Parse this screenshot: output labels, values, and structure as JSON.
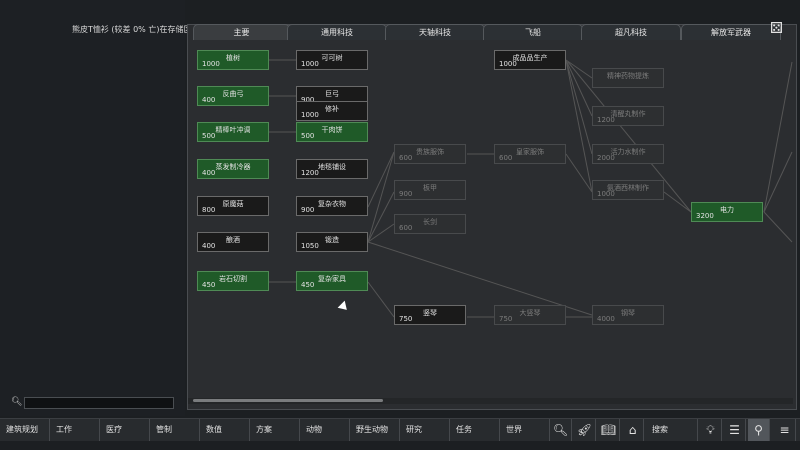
{
  "notice": "熊皮T恤衫 (较差 0% 亡)在存储区中因老化而损毁",
  "search": {
    "placeholder": "",
    "value": ""
  },
  "tabs": [
    "主要",
    "通用科技",
    "天轴科技",
    "飞船",
    "超凡科技",
    "解放军武器"
  ],
  "active_tab": "主要",
  "nodes": [
    {
      "id": "shuzhong",
      "name": "植树",
      "cost": "1000",
      "state": "done"
    },
    {
      "id": "kekeshu",
      "name": "可可树",
      "cost": "1000",
      "state": "avail"
    },
    {
      "id": "chengpin",
      "name": "成品品生产",
      "cost": "1000",
      "state": "avail"
    },
    {
      "id": "jingshen",
      "name": "精神药物提炼",
      "cost": "",
      "state": "locked"
    },
    {
      "id": "fanqugong",
      "name": "反曲弓",
      "cost": "400",
      "state": "done"
    },
    {
      "id": "jugong",
      "name": "巨弓",
      "cost": "900",
      "state": "avail"
    },
    {
      "id": "xiubu",
      "name": "修补",
      "cost": "1000",
      "state": "avail"
    },
    {
      "id": "qingxue",
      "name": "清醒丸制作",
      "cost": "1200",
      "state": "locked"
    },
    {
      "id": "jingbangye",
      "name": "精棒叶冲调",
      "cost": "500",
      "state": "done"
    },
    {
      "id": "ganroubing",
      "name": "干肉饼",
      "cost": "500",
      "state": "done"
    },
    {
      "id": "huolishui",
      "name": "活力水制作",
      "cost": "2000",
      "state": "locked"
    },
    {
      "id": "guizu",
      "name": "贵族服饰",
      "cost": "600",
      "state": "locked"
    },
    {
      "id": "huangjia",
      "name": "皇家服饰",
      "cost": "600",
      "state": "locked"
    },
    {
      "id": "kangshengsu",
      "name": "氨酒西林制作",
      "cost": "1000",
      "state": "locked"
    },
    {
      "id": "zhengfa",
      "name": "蒸发制冷器",
      "cost": "400",
      "state": "done"
    },
    {
      "id": "dilan",
      "name": "地毯铺设",
      "cost": "1200",
      "state": "avail"
    },
    {
      "id": "banjia",
      "name": "板甲",
      "cost": "900",
      "state": "locked"
    },
    {
      "id": "dianli",
      "name": "电力",
      "cost": "3200",
      "state": "done"
    },
    {
      "id": "yuanmo",
      "name": "原魔菇",
      "cost": "800",
      "state": "avail"
    },
    {
      "id": "fuza_yiwu",
      "name": "复杂衣物",
      "cost": "900",
      "state": "avail"
    },
    {
      "id": "changjian",
      "name": "长剑",
      "cost": "600",
      "state": "locked"
    },
    {
      "id": "niangjiu",
      "name": "酿酒",
      "cost": "400",
      "state": "avail"
    },
    {
      "id": "duanzao",
      "name": "锻造",
      "cost": "1050",
      "state": "avail"
    },
    {
      "id": "yanshi",
      "name": "岩石切割",
      "cost": "450",
      "state": "done"
    },
    {
      "id": "fuza_jiaju",
      "name": "复杂家具",
      "cost": "450",
      "state": "done"
    },
    {
      "id": "shuqin",
      "name": "竖琴",
      "cost": "750",
      "state": "avail"
    },
    {
      "id": "dashuqin",
      "name": "大竖琴",
      "cost": "750",
      "state": "locked"
    },
    {
      "id": "gangqin",
      "name": "钢琴",
      "cost": "4000",
      "state": "locked"
    }
  ],
  "bottom_bar": [
    "建筑规划",
    "工作",
    "医疗",
    "管制",
    "数值",
    "方案",
    "动物",
    "野生动物",
    "研究",
    "任务",
    "世界",
    "搜索"
  ],
  "icons": [
    "search-icon",
    "rocket-icon",
    "book-icon",
    "factory-icon",
    "lightbulb-icon",
    "schedule-icon",
    "broom-icon",
    "menu-icon",
    "dice-icon"
  ]
}
